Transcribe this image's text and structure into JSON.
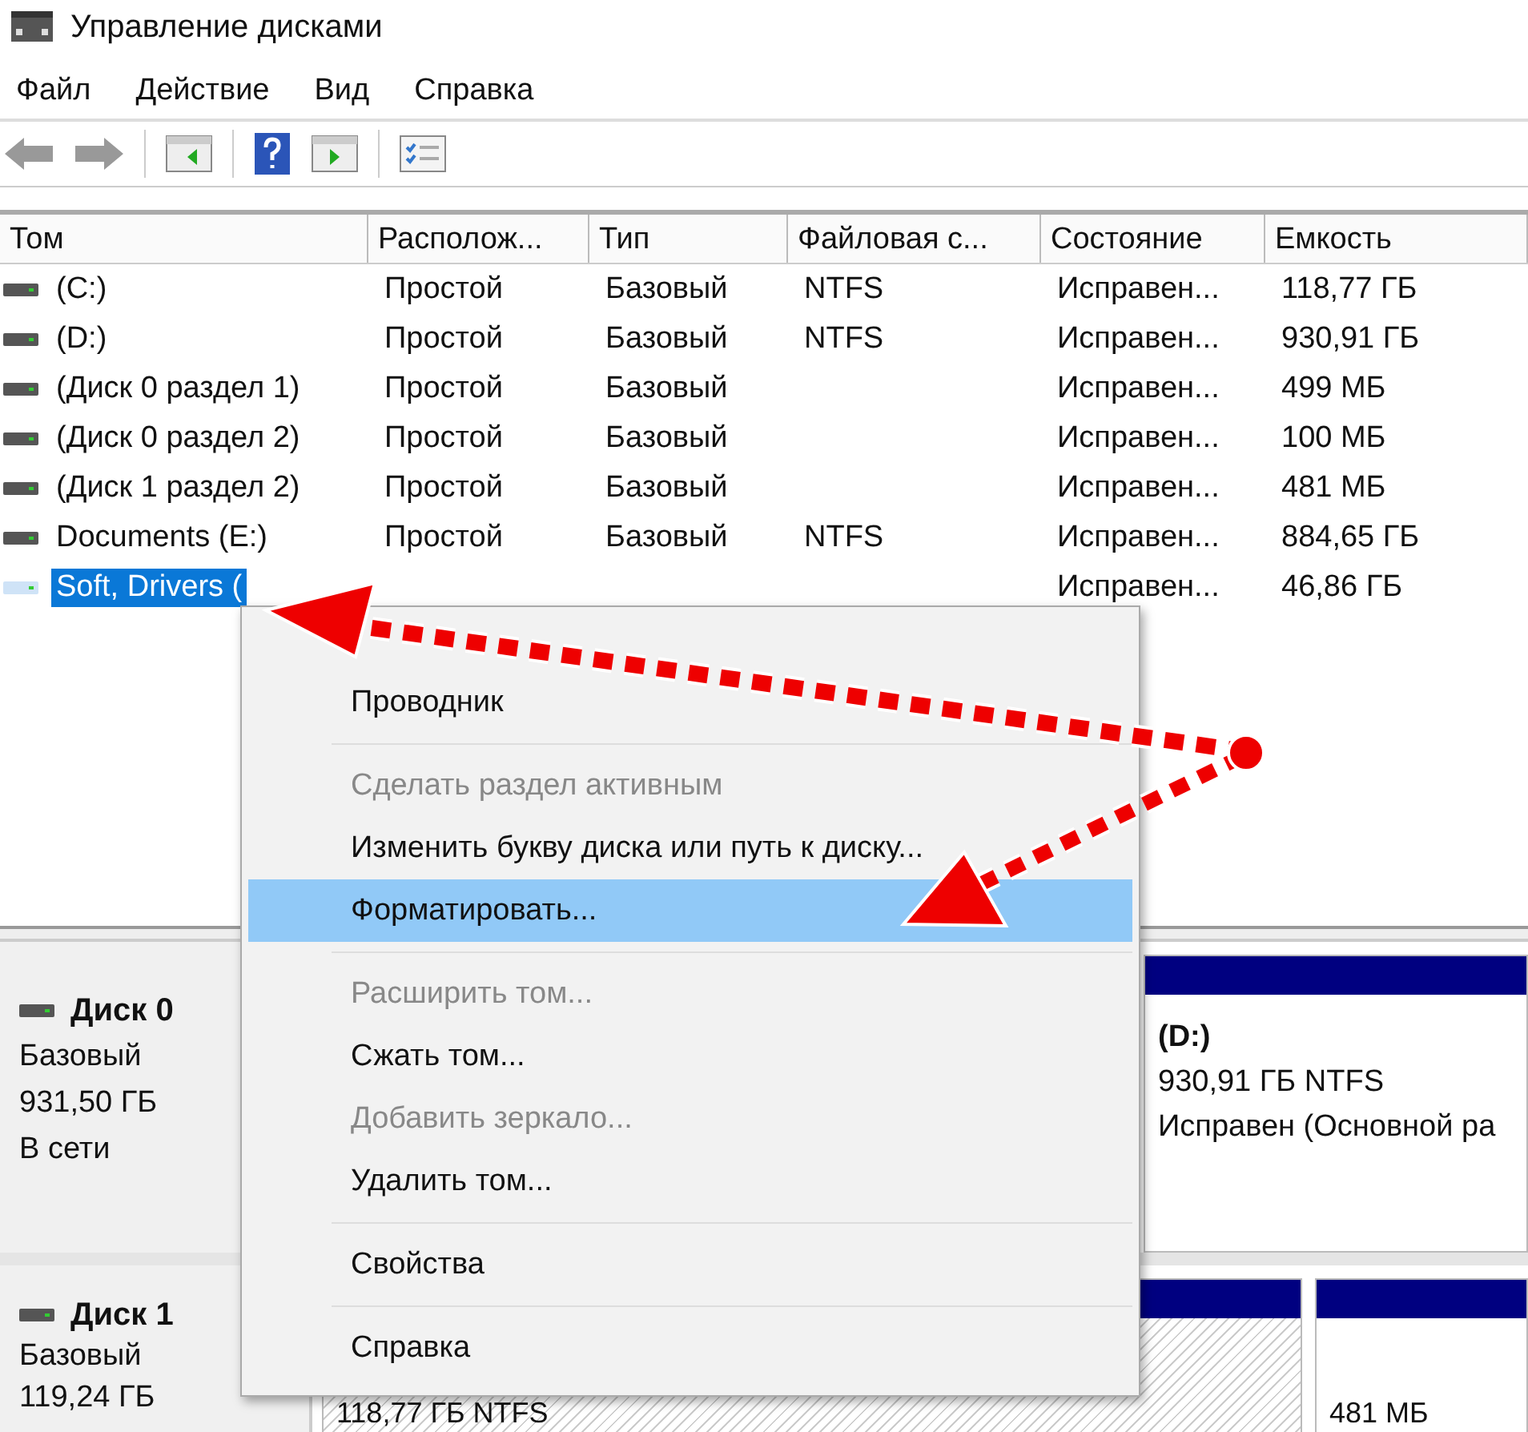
{
  "window": {
    "title": "Управление дисками"
  },
  "menu_bar": [
    "Файл",
    "Действие",
    "Вид",
    "Справка"
  ],
  "table": {
    "columns": [
      "Том",
      "Располож...",
      "Тип",
      "Файловая с...",
      "Состояние",
      "Емкость"
    ],
    "rows": [
      {
        "selected": false,
        "cells": [
          "(C:)",
          "Простой",
          "Базовый",
          "NTFS",
          "Исправен...",
          "118,77 ГБ"
        ]
      },
      {
        "selected": false,
        "cells": [
          "(D:)",
          "Простой",
          "Базовый",
          "NTFS",
          "Исправен...",
          "930,91 ГБ"
        ]
      },
      {
        "selected": false,
        "cells": [
          "(Диск 0 раздел 1)",
          "Простой",
          "Базовый",
          "",
          "Исправен...",
          "499 МБ"
        ]
      },
      {
        "selected": false,
        "cells": [
          "(Диск 0 раздел 2)",
          "Простой",
          "Базовый",
          "",
          "Исправен...",
          "100 МБ"
        ]
      },
      {
        "selected": false,
        "cells": [
          "(Диск 1 раздел 2)",
          "Простой",
          "Базовый",
          "",
          "Исправен...",
          "481 МБ"
        ]
      },
      {
        "selected": false,
        "cells": [
          "Documents (E:)",
          "Простой",
          "Базовый",
          "NTFS",
          "Исправен...",
          "884,65 ГБ"
        ]
      },
      {
        "selected": true,
        "cells": [
          "Soft, Drivers (",
          "",
          "",
          "",
          "Исправен...",
          "46,86 ГБ"
        ]
      }
    ]
  },
  "disks": [
    {
      "name": "Диск 0",
      "type": "Базовый",
      "size": "931,50 ГБ",
      "status": "В сети",
      "partitions": [
        {
          "kind": "primary",
          "label": "(D:)",
          "detail": "930,91 ГБ NTFS",
          "status": "Исправен (Основной ра"
        }
      ]
    },
    {
      "name": "Диск 1",
      "type": "Базовый",
      "size": "119,24 ГБ",
      "partitions": [
        {
          "kind": "hatched",
          "detail": "118,77 ГБ NTFS"
        },
        {
          "kind": "primary",
          "detail": "481 МБ"
        }
      ]
    }
  ],
  "context_menu": [
    {
      "kind": "item",
      "label": "Проводник",
      "disabled": false,
      "selected": false
    },
    {
      "kind": "separator"
    },
    {
      "kind": "item",
      "label": "Сделать раздел активным",
      "disabled": true,
      "selected": false
    },
    {
      "kind": "item",
      "label": "Изменить букву диска или путь к диску...",
      "disabled": false,
      "selected": false
    },
    {
      "kind": "item",
      "label": "Форматировать...",
      "disabled": false,
      "selected": true
    },
    {
      "kind": "separator"
    },
    {
      "kind": "item",
      "label": "Расширить том...",
      "disabled": true,
      "selected": false
    },
    {
      "kind": "item",
      "label": "Сжать том...",
      "disabled": false,
      "selected": false
    },
    {
      "kind": "item",
      "label": "Добавить зеркало...",
      "disabled": true,
      "selected": false
    },
    {
      "kind": "item",
      "label": "Удалить том...",
      "disabled": false,
      "selected": false
    },
    {
      "kind": "separator"
    },
    {
      "kind": "item",
      "label": "Свойства",
      "disabled": false,
      "selected": false
    },
    {
      "kind": "separator"
    },
    {
      "kind": "item",
      "label": "Справка",
      "disabled": false,
      "selected": false
    }
  ]
}
